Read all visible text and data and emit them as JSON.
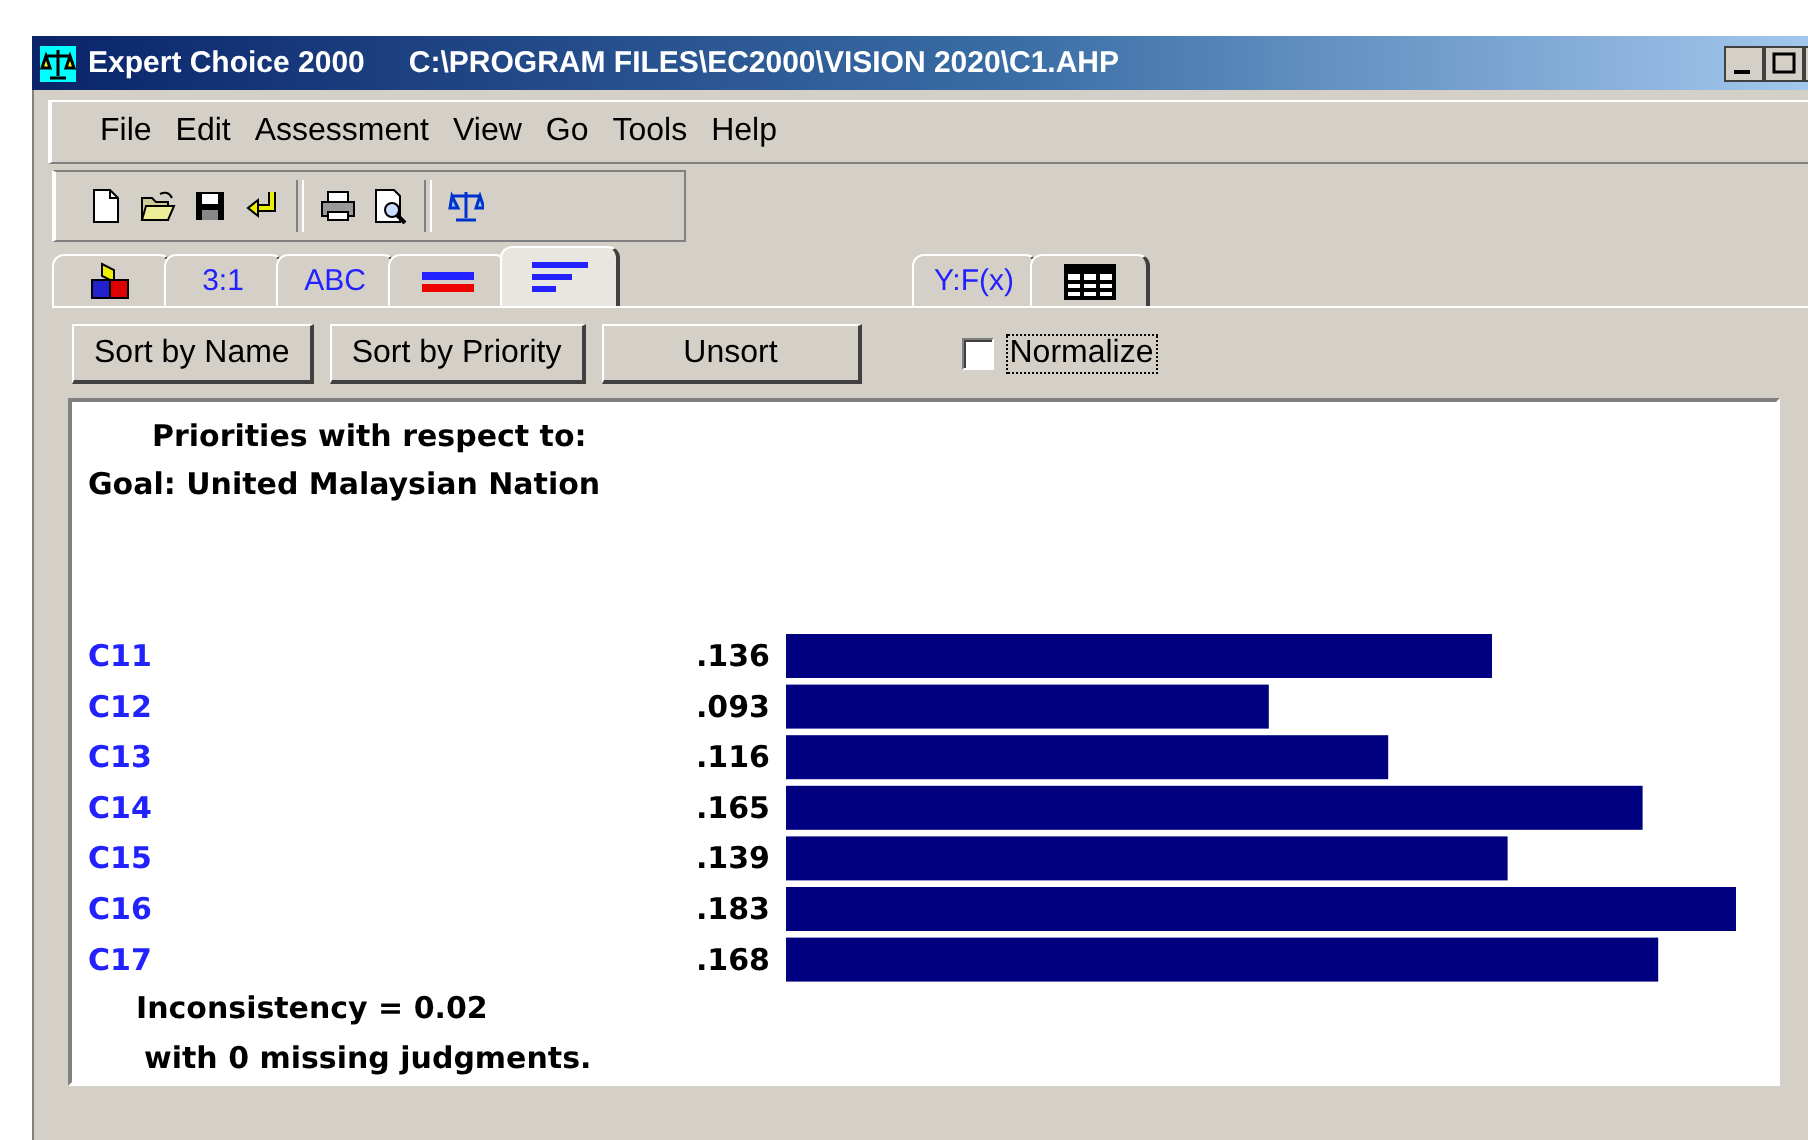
{
  "window": {
    "title": "Expert Choice 2000",
    "path": "C:\\PROGRAM FILES\\EC2000\\VISION 2020\\C1.AHP"
  },
  "menu": [
    "File",
    "Edit",
    "Assessment",
    "View",
    "Go",
    "Tools",
    "Help"
  ],
  "toolbar": [
    {
      "kind": "new"
    },
    {
      "kind": "open"
    },
    {
      "kind": "save"
    },
    {
      "kind": "undo"
    },
    {
      "kind": "sep"
    },
    {
      "kind": "print"
    },
    {
      "kind": "preview"
    },
    {
      "kind": "sep"
    },
    {
      "kind": "scale"
    }
  ],
  "tabs": [
    {
      "kind": "blocks",
      "selected": false
    },
    {
      "kind": "text",
      "label": "3:1",
      "selected": false
    },
    {
      "kind": "text",
      "label": "ABC",
      "selected": false
    },
    {
      "kind": "bars2",
      "selected": false
    },
    {
      "kind": "sortlines",
      "selected": true
    },
    {
      "kind": "gap"
    },
    {
      "kind": "text",
      "label": "Y:F(x)",
      "selected": false
    },
    {
      "kind": "grid",
      "selected": false
    }
  ],
  "buttons": [
    "Sort by Name",
    "Sort by Priority",
    "Unsort"
  ],
  "normalize": {
    "label": "Normalize",
    "checked": false
  },
  "heading": [
    "Priorities with respect to:",
    "Goal: United Malaysian Nation"
  ],
  "chart_data": {
    "type": "bar",
    "orientation": "horizontal",
    "categories": [
      "C11",
      "C12",
      "C13",
      "C14",
      "C15",
      "C16",
      "C17"
    ],
    "values": [
      0.136,
      0.093,
      0.116,
      0.165,
      0.139,
      0.183,
      0.168
    ],
    "value_labels": [
      ".136",
      ".093",
      ".116",
      ".165",
      ".139",
      ".183",
      ".168"
    ]
  },
  "footer": [
    "Inconsistency = 0.02",
    "with 0  missing judgments."
  ]
}
